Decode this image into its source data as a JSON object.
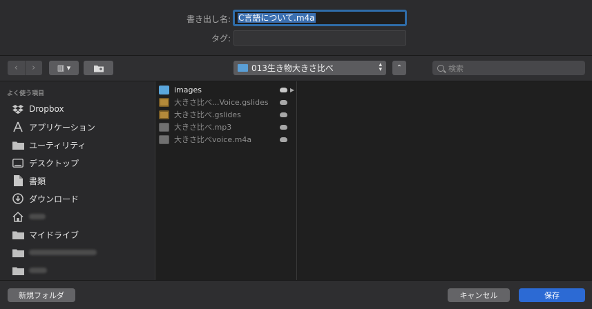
{
  "form": {
    "name_label": "書き出し名:",
    "name_value": "C言語について.m4a",
    "tag_label": "タグ:",
    "tag_value": ""
  },
  "toolbar": {
    "back_glyph": "‹",
    "forward_glyph": "›",
    "view_glyph": "▥ ▾",
    "location": "013生き物大きさ比べ",
    "expand_glyph": "⌃",
    "search_placeholder": "検索"
  },
  "sidebar": {
    "title": "よく使う項目",
    "items": [
      {
        "label": "Dropbox",
        "icon": "dropbox-icon"
      },
      {
        "label": "アプリケーション",
        "icon": "applications-icon"
      },
      {
        "label": "ユーティリティ",
        "icon": "folder-icon"
      },
      {
        "label": "デスクトップ",
        "icon": "desktop-icon"
      },
      {
        "label": "書類",
        "icon": "document-icon"
      },
      {
        "label": "ダウンロード",
        "icon": "download-icon"
      },
      {
        "label": "",
        "icon": "home-icon"
      },
      {
        "label": "マイドライブ",
        "icon": "folder-icon"
      },
      {
        "label": "",
        "icon": "folder-icon"
      },
      {
        "label": "",
        "icon": "folder-icon"
      }
    ]
  },
  "files": [
    {
      "name": "images",
      "type": "folder",
      "icon": "folder-icon",
      "has_arrow": true
    },
    {
      "name": "大きさ比べ...Voice.gslides",
      "type": "gslides",
      "icon": "gslides-icon"
    },
    {
      "name": "大きさ比べ.gslides",
      "type": "gslides",
      "icon": "gslides-icon"
    },
    {
      "name": "大きさ比べ.mp3",
      "type": "audio",
      "icon": "audio-file-icon"
    },
    {
      "name": "大きさ比べvoice.m4a",
      "type": "audio",
      "icon": "audio-file-icon"
    }
  ],
  "buttons": {
    "new_folder": "新規フォルダ",
    "cancel": "キャンセル",
    "save": "保存"
  },
  "colors": {
    "accent": "#2c6ad4",
    "folder": "#5aa6dc",
    "focus_ring": "#2f6ca8"
  }
}
